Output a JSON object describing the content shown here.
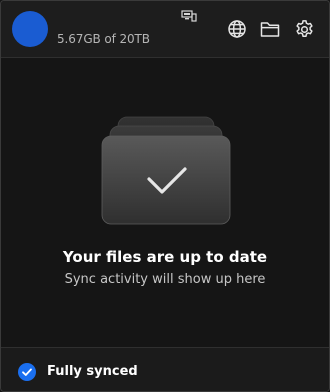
{
  "header": {
    "avatar_color": "#1a5cd2",
    "storage_text": "5.67GB of 20TB",
    "icons": {
      "tray": "tray-status-icon",
      "web": "globe-icon",
      "folder": "folder-icon",
      "settings": "gear-icon"
    }
  },
  "main": {
    "illustration": "stacked-files-checkmark-icon",
    "title": "Your files are up to date",
    "subtitle": "Sync activity will show up here"
  },
  "footer": {
    "status_icon": "check-circle-icon",
    "status_color": "#1a6ff0",
    "status_text": "Fully synced"
  }
}
